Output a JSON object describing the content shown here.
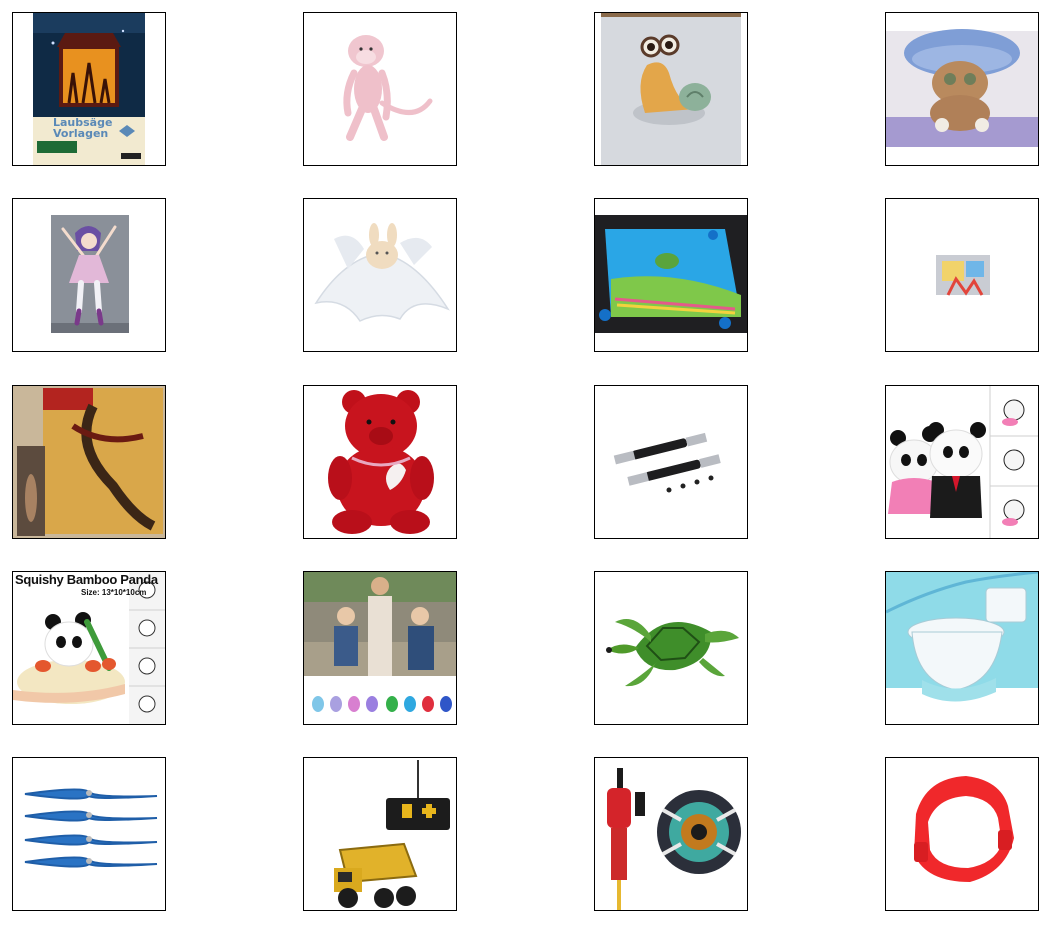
{
  "grid": {
    "items": [
      {
        "name": "laubsaege-lantern",
        "caption_line1": "Laubsäge",
        "caption_line2": "Vorlagen"
      },
      {
        "name": "pink-plush-monkey"
      },
      {
        "name": "snail-figurine"
      },
      {
        "name": "mushroom-hat-creature"
      },
      {
        "name": "anime-girl-figure"
      },
      {
        "name": "bunny-comforter-blanket"
      },
      {
        "name": "blue-frog-comforter"
      },
      {
        "name": "small-toy-set"
      },
      {
        "name": "marvel-figure-box"
      },
      {
        "name": "red-teddy-bear"
      },
      {
        "name": "rc-drive-shafts"
      },
      {
        "name": "panda-couple-squishy"
      },
      {
        "name": "squishy-bamboo-panda",
        "title": "Squishy Bamboo Panda",
        "size_text": "Size: 13*10*10cm"
      },
      {
        "name": "kids-with-tamagotchi"
      },
      {
        "name": "sea-turtle-toy"
      },
      {
        "name": "baby-potty-seat"
      },
      {
        "name": "blue-propellers"
      },
      {
        "name": "rc-dump-truck"
      },
      {
        "name": "beyblade-launcher"
      },
      {
        "name": "red-potty-ring"
      }
    ]
  }
}
